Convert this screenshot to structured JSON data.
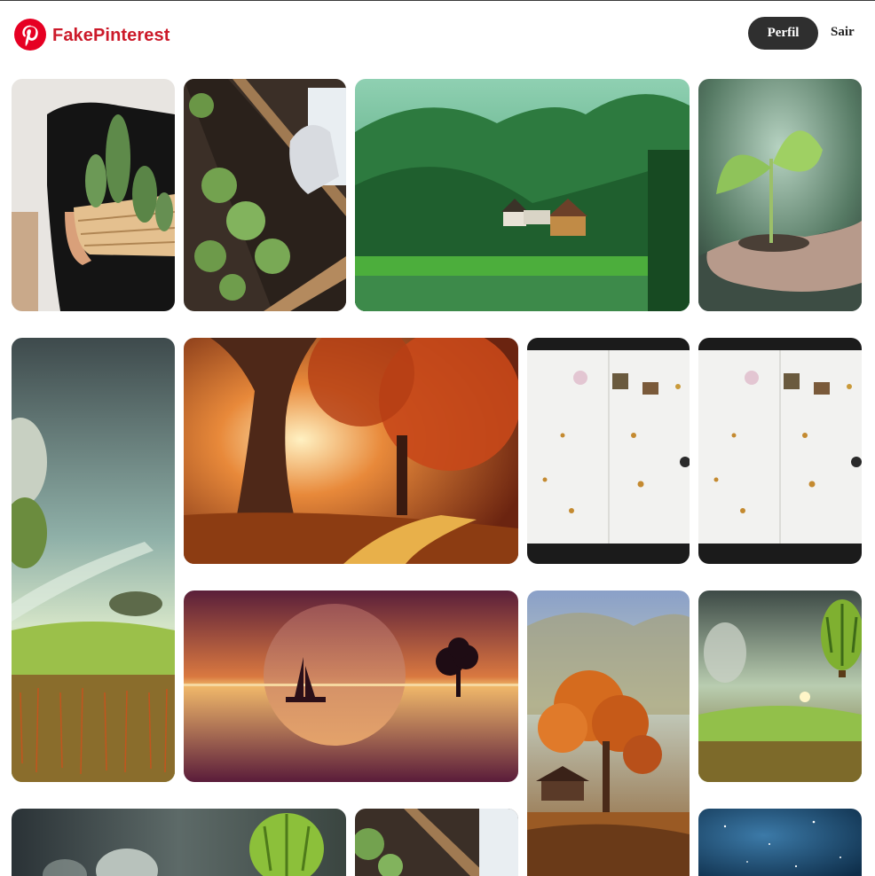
{
  "header": {
    "brand_name": "FakePinterest",
    "brand_color": "#cc1a2a",
    "profile_button_label": "Perfil",
    "logout_link_label": "Sair"
  },
  "feed": {
    "pins": [
      {
        "subject": "person holding potted cactus in woven basket"
      },
      {
        "subject": "lettuce seedlings in wooden planter box with gardening glove"
      },
      {
        "subject": "wooden house by green lake in forested valley"
      },
      {
        "subject": "sapling with soil in cupped hand"
      },
      {
        "subject": "surreal landscape with UMN hot air balloon over field"
      },
      {
        "subject": "autumn forest with sun rays and large tree"
      },
      {
        "subject": "handmade paper with seeds and miniature figures"
      },
      {
        "subject": "handmade paper with seeds and miniature figures"
      },
      {
        "subject": "sunset with giant moon, sailboat and tree reflected in water"
      },
      {
        "subject": "orange autumn tree with gazebo in misty hills"
      },
      {
        "subject": "surreal landscape with UMN hot air balloon over field"
      },
      {
        "subject": "surreal landscape with UMN hot air balloon"
      },
      {
        "subject": "lettuce seedlings in wooden planter box with gardening glove"
      },
      {
        "subject": "blue starry night sky"
      }
    ]
  }
}
